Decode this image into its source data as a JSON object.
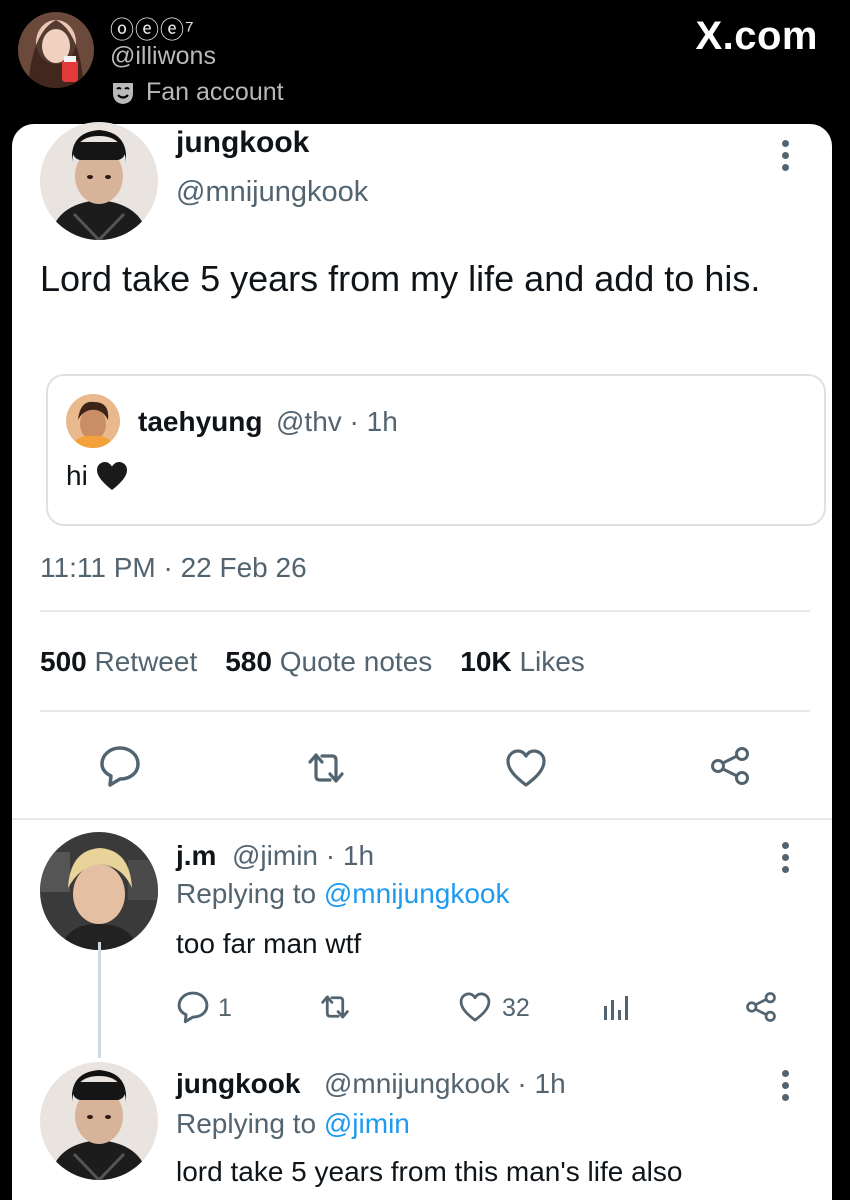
{
  "header": {
    "account_name": "ⓞⓔⓔ⁷",
    "account_handle": "@illiwons",
    "fan_label": "Fan account",
    "site_label": "X.com"
  },
  "tweet": {
    "author_name": "jungkook",
    "author_handle": "@mnijungkook",
    "text": "Lord take 5 years from my life and add to his.",
    "quoted": {
      "name": "taehyung",
      "meta": "@thv · 1h",
      "text": "hi",
      "emoji": "black-heart"
    },
    "timestamp": "11:11 PM · 22 Feb 26",
    "stats": [
      {
        "count": "500",
        "label": "Retweet"
      },
      {
        "count": "580",
        "label": "Quote notes"
      },
      {
        "count": "10K",
        "label": "Likes"
      }
    ],
    "actions": [
      "reply-icon",
      "retweet-icon",
      "like-icon",
      "share-icon"
    ]
  },
  "replies": [
    {
      "name": "j.m",
      "meta": "@jimin · 1h",
      "replying_prefix": "Replying to ",
      "replying_to": "@mnijungkook",
      "text": "too far man wtf",
      "reply_count": "1",
      "like_count": "32"
    },
    {
      "name": "jungkook",
      "meta": "@mnijungkook · 1h",
      "replying_prefix": "Replying to ",
      "replying_to": "@jimin",
      "text": "lord take 5 years from this man's life also"
    }
  ],
  "colors": {
    "link": "#1d9bf0",
    "secondary_text": "#536471",
    "primary_text": "#0f1419",
    "background": "#000000"
  }
}
